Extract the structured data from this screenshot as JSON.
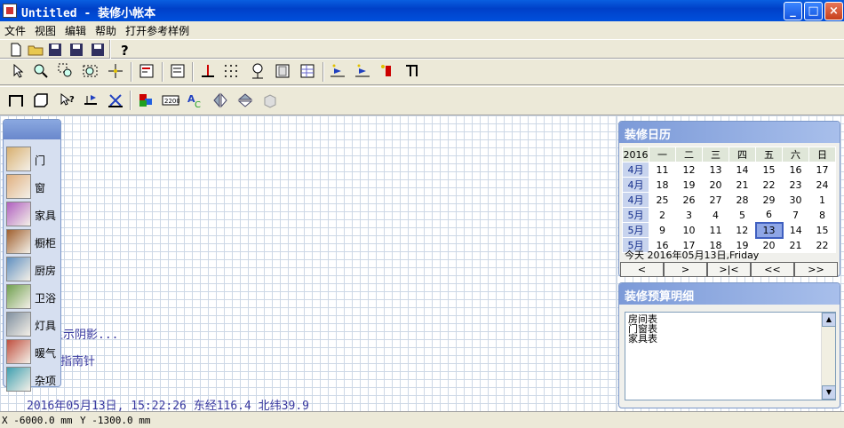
{
  "window": {
    "title": "Untitled - 装修小帐本"
  },
  "menu": [
    "文件",
    "视图",
    "编辑",
    "帮助",
    "打开参考样例"
  ],
  "palette": [
    {
      "label": "门",
      "icon": "door-icon",
      "color": "#d8b070"
    },
    {
      "label": "窗",
      "icon": "window-icon",
      "color": "#e0b080"
    },
    {
      "label": "家具",
      "icon": "furniture-icon",
      "color": "#b060c0"
    },
    {
      "label": "橱柜",
      "icon": "cabinet-icon",
      "color": "#a06030"
    },
    {
      "label": "厨房",
      "icon": "kitchen-icon",
      "color": "#6090c0"
    },
    {
      "label": "卫浴",
      "icon": "bathroom-icon",
      "color": "#70a050"
    },
    {
      "label": "灯具",
      "icon": "lamp-icon",
      "color": "#8090a0"
    },
    {
      "label": "暖气",
      "icon": "radiator-icon",
      "color": "#c05040"
    },
    {
      "label": "杂项",
      "icon": "misc-icon",
      "color": "#40a0b0"
    }
  ],
  "canvas": {
    "shadow_text": "显示阴影...",
    "compass_text": "指南针",
    "datetime": "2016年05月13日, 15:22:26   东经116.4 北纬39.9"
  },
  "calendar": {
    "title": "装修日历",
    "year": "2016",
    "weekdays": [
      "一",
      "二",
      "三",
      "四",
      "五",
      "六",
      "日"
    ],
    "rows": [
      {
        "month": "4月",
        "days": [
          "11",
          "12",
          "13",
          "14",
          "15",
          "16",
          "17"
        ]
      },
      {
        "month": "4月",
        "days": [
          "18",
          "19",
          "20",
          "21",
          "22",
          "23",
          "24"
        ]
      },
      {
        "month": "4月",
        "days": [
          "25",
          "26",
          "27",
          "28",
          "29",
          "30",
          "1"
        ]
      },
      {
        "month": "5月",
        "days": [
          "2",
          "3",
          "4",
          "5",
          "6",
          "7",
          "8"
        ]
      },
      {
        "month": "5月",
        "days": [
          "9",
          "10",
          "11",
          "12",
          "13",
          "14",
          "15"
        ]
      },
      {
        "month": "5月",
        "days": [
          "16",
          "17",
          "18",
          "19",
          "20",
          "21",
          "22"
        ]
      }
    ],
    "today": "今天 2016年05月13日,Friday",
    "nav": [
      "<",
      ">",
      ">|<",
      "<<",
      ">>"
    ]
  },
  "budget": {
    "title": "装修预算明细",
    "items": [
      "房间表",
      "门窗表",
      "家具表"
    ]
  },
  "status": {
    "x": "X -6000.0 mm",
    "y": "Y -1300.0 mm"
  }
}
